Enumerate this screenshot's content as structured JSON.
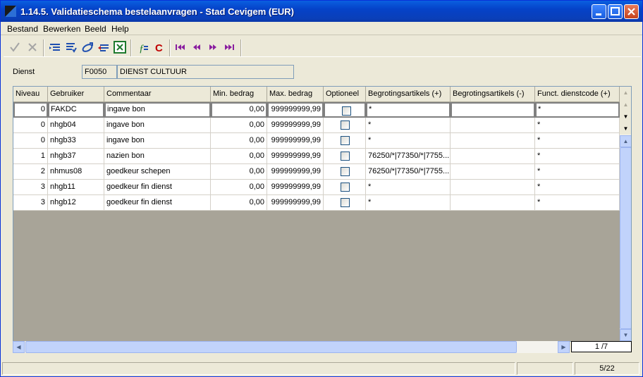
{
  "window": {
    "title": "1.14.5. Validatieschema bestelaanvragen - Stad Cevigem (EUR)"
  },
  "menubar": {
    "items": [
      "Bestand",
      "Bewerken",
      "Beeld",
      "Help"
    ]
  },
  "toolbar": {
    "icons": [
      "checkmark-icon",
      "cancel-x-icon",
      "indent-icon",
      "outdent-icon",
      "link-icon",
      "back-arrow-icon",
      "excel-icon",
      "calc-icon",
      "refresh-c-icon",
      "first-record-icon",
      "previous-record-icon",
      "next-record-icon",
      "last-record-icon"
    ]
  },
  "filter": {
    "label": "Dienst",
    "code": "F0050",
    "name": "DIENST CULTUUR"
  },
  "table": {
    "columns": [
      "Niveau",
      "Gebruiker",
      "Commentaar",
      "Min. bedrag",
      "Max. bedrag",
      "Optioneel",
      "Begrotingsartikels (+)",
      "Begrotingsartikels (-)",
      "Funct. dienstcode (+)"
    ],
    "rows": [
      {
        "niveau": "0",
        "gebruiker": "FAKDC",
        "commentaar": "ingave bon",
        "min": "0,00",
        "max": "999999999,99",
        "optioneel": false,
        "plus": "*",
        "minus": "",
        "funct": "*"
      },
      {
        "niveau": "0",
        "gebruiker": "nhgb04",
        "commentaar": "ingave bon",
        "min": "0,00",
        "max": "999999999,99",
        "optioneel": false,
        "plus": "*",
        "minus": "",
        "funct": "*"
      },
      {
        "niveau": "0",
        "gebruiker": "nhgb33",
        "commentaar": "ingave bon",
        "min": "0,00",
        "max": "999999999,99",
        "optioneel": false,
        "plus": "*",
        "minus": "",
        "funct": "*"
      },
      {
        "niveau": "1",
        "gebruiker": "nhgb37",
        "commentaar": "nazien bon",
        "min": "0,00",
        "max": "999999999,99",
        "optioneel": false,
        "plus": "76250/*|77350/*|7755...",
        "minus": "",
        "funct": "*"
      },
      {
        "niveau": "2",
        "gebruiker": "nhmus08",
        "commentaar": "goedkeur schepen",
        "min": "0,00",
        "max": "999999999,99",
        "optioneel": false,
        "plus": "76250/*|77350/*|7755...",
        "minus": "",
        "funct": "*"
      },
      {
        "niveau": "3",
        "gebruiker": "nhgb11",
        "commentaar": "goedkeur fin dienst",
        "min": "0,00",
        "max": "999999999,99",
        "optioneel": false,
        "plus": "*",
        "minus": "",
        "funct": "*"
      },
      {
        "niveau": "3",
        "gebruiker": "nhgb12",
        "commentaar": "goedkeur fin dienst",
        "min": "0,00",
        "max": "999999999,99",
        "optioneel": false,
        "plus": "*",
        "minus": "",
        "funct": "*"
      }
    ]
  },
  "pager": {
    "text": "1 /7"
  },
  "statusbar": {
    "left": "",
    "middle": "",
    "right": "5/22"
  },
  "colors": {
    "titlebar": "#0a50d8",
    "grid_bg": "#a8a498",
    "nav_purple": "#8a1ea0",
    "refresh_red": "#c00000"
  }
}
